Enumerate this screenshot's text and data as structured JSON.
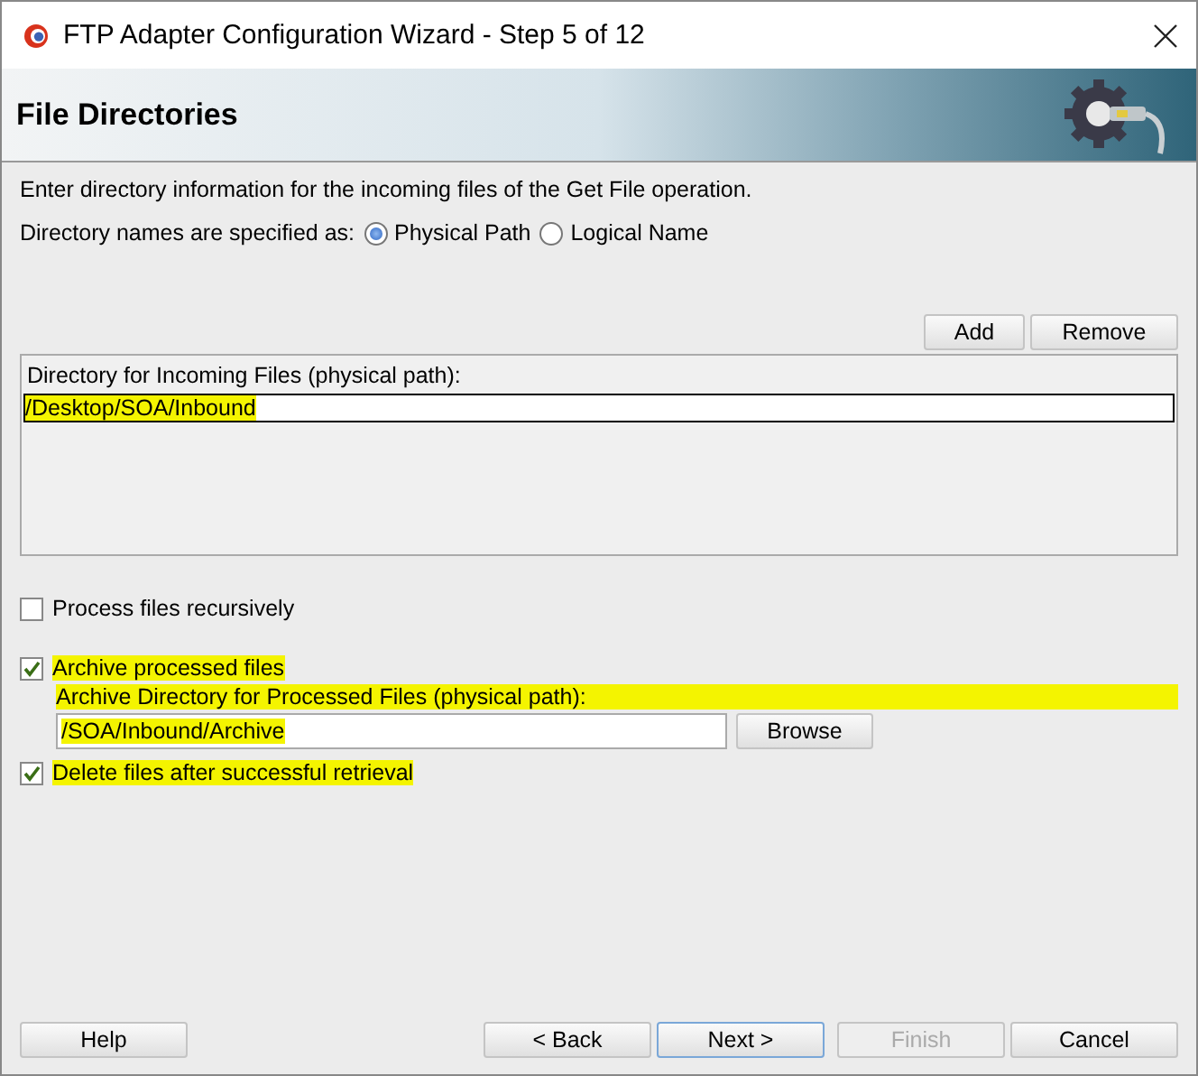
{
  "window": {
    "title": "FTP Adapter Configuration Wizard - Step 5 of 12"
  },
  "header": {
    "title": "File Directories"
  },
  "intro": "Enter directory information for the incoming files of the Get File operation.",
  "directory_names": {
    "label": "Directory names are specified as:",
    "options": [
      {
        "label": "Physical Path",
        "selected": true
      },
      {
        "label": "Logical Name",
        "selected": false
      }
    ]
  },
  "list_buttons": [
    "Add",
    "Remove"
  ],
  "incoming": {
    "heading": "Directory for Incoming Files (physical path):",
    "rows": [
      {
        "value": "/Desktop/SOA/Inbound",
        "selected": true,
        "highlighted": true
      }
    ]
  },
  "options": [
    {
      "kind": "checkbox",
      "label": "Process files recursively",
      "checked": false,
      "highlighted": false
    },
    {
      "kind": "checkbox",
      "label": "Archive processed files",
      "checked": true,
      "highlighted": true
    },
    {
      "kind": "field",
      "label": "Archive Directory for Processed Files (physical path):",
      "value": "/SOA/Inbound/Archive",
      "button": "Browse",
      "highlighted": true
    },
    {
      "kind": "checkbox",
      "label": "Delete files after successful retrieval",
      "checked": true,
      "highlighted": true
    }
  ],
  "footer": {
    "left": [
      {
        "label": "Help",
        "disabled": false
      }
    ],
    "right": [
      {
        "label": "< Back",
        "disabled": false,
        "default": false
      },
      {
        "label": "Next >",
        "disabled": false,
        "default": true
      },
      {
        "label": "Finish",
        "disabled": true,
        "default": false
      },
      {
        "label": "Cancel",
        "disabled": false,
        "default": false
      }
    ]
  }
}
